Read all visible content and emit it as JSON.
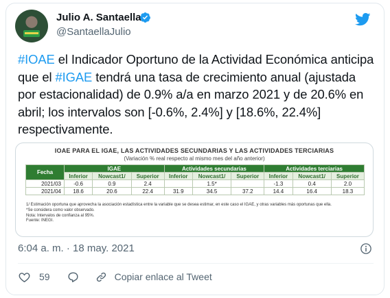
{
  "tweet": {
    "author_name": "Julio A. Santaella",
    "author_handle": "@SantaellaJulio",
    "text_parts": [
      {
        "text": "#IOAE",
        "hashtag": true
      },
      {
        "text": " el Indicador Oportuno de la Actividad Económica anticipa que el ",
        "hashtag": false
      },
      {
        "text": "#IGAE",
        "hashtag": true
      },
      {
        "text": " tendrá una tasa de crecimiento anual (ajustada por estacionalidad) de 0.9% a/a en marzo 2021 y de 20.6% en abril; los intervalos son [-0.6%, 2.4%] y [18.6%, 22.4%] respectivamente.",
        "hashtag": false
      }
    ],
    "timestamp": "6:04 a. m. · 18 may. 2021",
    "like_count": "59",
    "copy_link_label": "Copiar enlace al Tweet"
  },
  "media_table": {
    "title": "IOAE PARA EL IGAE, LAS ACTIVIDADES SECUNDARIAS Y LAS ACTIVIDADES TERCIARIAS",
    "subtitle": "(Variación % real respecto al mismo mes del año anterior)",
    "fecha_header": "Fecha",
    "group_headers": [
      "IGAE",
      "Actividades secundarias",
      "Actividades terciarias"
    ],
    "sub_headers": [
      "Inferior",
      "Nowcast1/",
      "Superior",
      "Inferior",
      "Nowcast1/",
      "Superior",
      "Inferior",
      "Nowcast1/",
      "Superior"
    ],
    "rows": [
      {
        "fecha": "2021/03",
        "cells": [
          "-0.6",
          "0.9",
          "2.4",
          "",
          "1.5*",
          "",
          "-1.3",
          "0.4",
          "2.0"
        ]
      },
      {
        "fecha": "2021/04",
        "cells": [
          "18.6",
          "20.6",
          "22.4",
          "31.9",
          "34.5",
          "37.2",
          "14.4",
          "16.4",
          "18.3"
        ]
      }
    ],
    "notes": [
      "1/ Estimación oportuna que aprovecha la asociación estadística entre la variable que se desea estimar, en este caso el IGAE, y otras variables más oportunas que ella.",
      "*Se considera como valor observado.",
      "Nota: Intervalos de confianza al 95%.",
      "Fuente: INEGI."
    ]
  },
  "colors": {
    "hashtag": "#1d9bf0",
    "table_header_green": "#2f7d32",
    "table_subheader_bg": "#e5efdf",
    "muted_text": "#536471"
  },
  "icons": [
    "twitter-bird-icon",
    "verified-badge-icon",
    "info-icon",
    "heart-icon",
    "reply-icon",
    "link-icon"
  ]
}
